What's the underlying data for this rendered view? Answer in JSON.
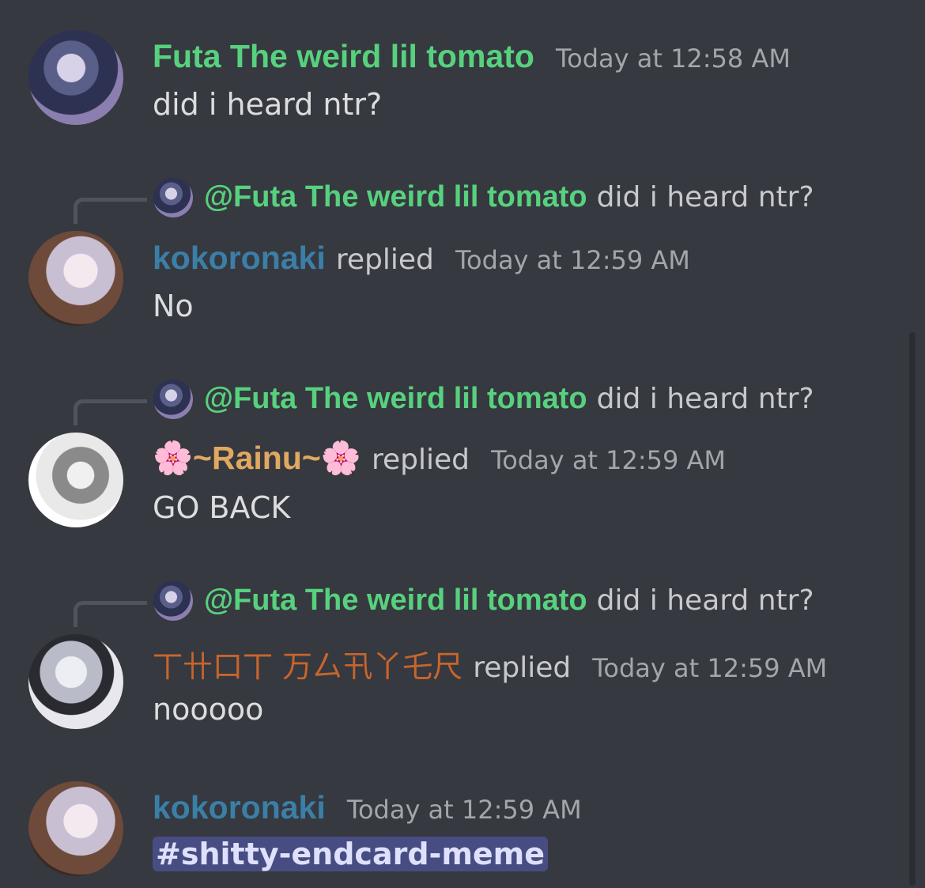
{
  "messages": [
    {
      "username": "Futa The weird lil tomato",
      "username_color": "#57d17e",
      "timestamp": "Today at 12:58 AM",
      "content": "did i heard ntr?"
    },
    {
      "reply_to": {
        "name": "@Futa The weird lil tomato",
        "text": "did i heard ntr?"
      },
      "username": "kokoronaki",
      "username_color": "#3b7fa8",
      "replied_label": "replied",
      "timestamp": "Today at 12:59 AM",
      "content": "No"
    },
    {
      "reply_to": {
        "name": "@Futa The weird lil tomato",
        "text": "did i heard ntr?"
      },
      "username": "🌸~Rainu~🌸",
      "username_color": "#e0a860",
      "replied_label": "replied",
      "timestamp": "Today at 12:59 AM",
      "content": "GO BACK"
    },
    {
      "reply_to": {
        "name": "@Futa The weird lil tomato",
        "text": "did i heard ntr?"
      },
      "username": "丅卄口丅 万厶卂丫乇尺",
      "username_color": "#c8652c",
      "replied_label": "replied",
      "timestamp": "Today at 12:59 AM",
      "content": "nooooo"
    },
    {
      "username": "kokoronaki",
      "username_color": "#3b7fa8",
      "timestamp": "Today at 12:59 AM",
      "content": "#shitty-endcard-meme"
    }
  ]
}
